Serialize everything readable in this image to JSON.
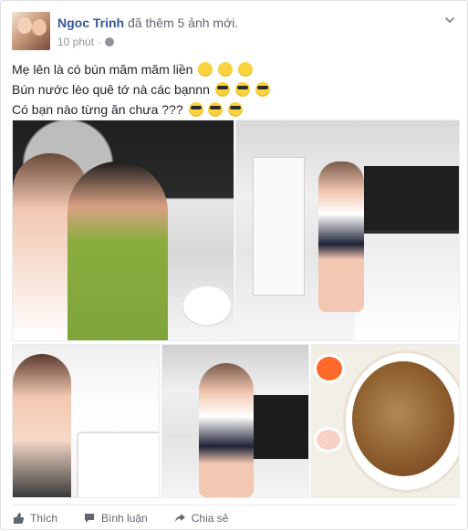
{
  "post": {
    "author": "Ngoc Trinh",
    "action": "đã thêm 5 ảnh mới.",
    "time": "10 phút",
    "lines": [
      "Mẹ lên là có bún măm măm liền",
      "Bún nước lèo quê tớ nà các bạnnn",
      "Có bạn nào từng ăn chưa ???"
    ]
  },
  "actions": {
    "like": "Thích",
    "comment": "Bình luận",
    "share": "Chia sẻ"
  }
}
